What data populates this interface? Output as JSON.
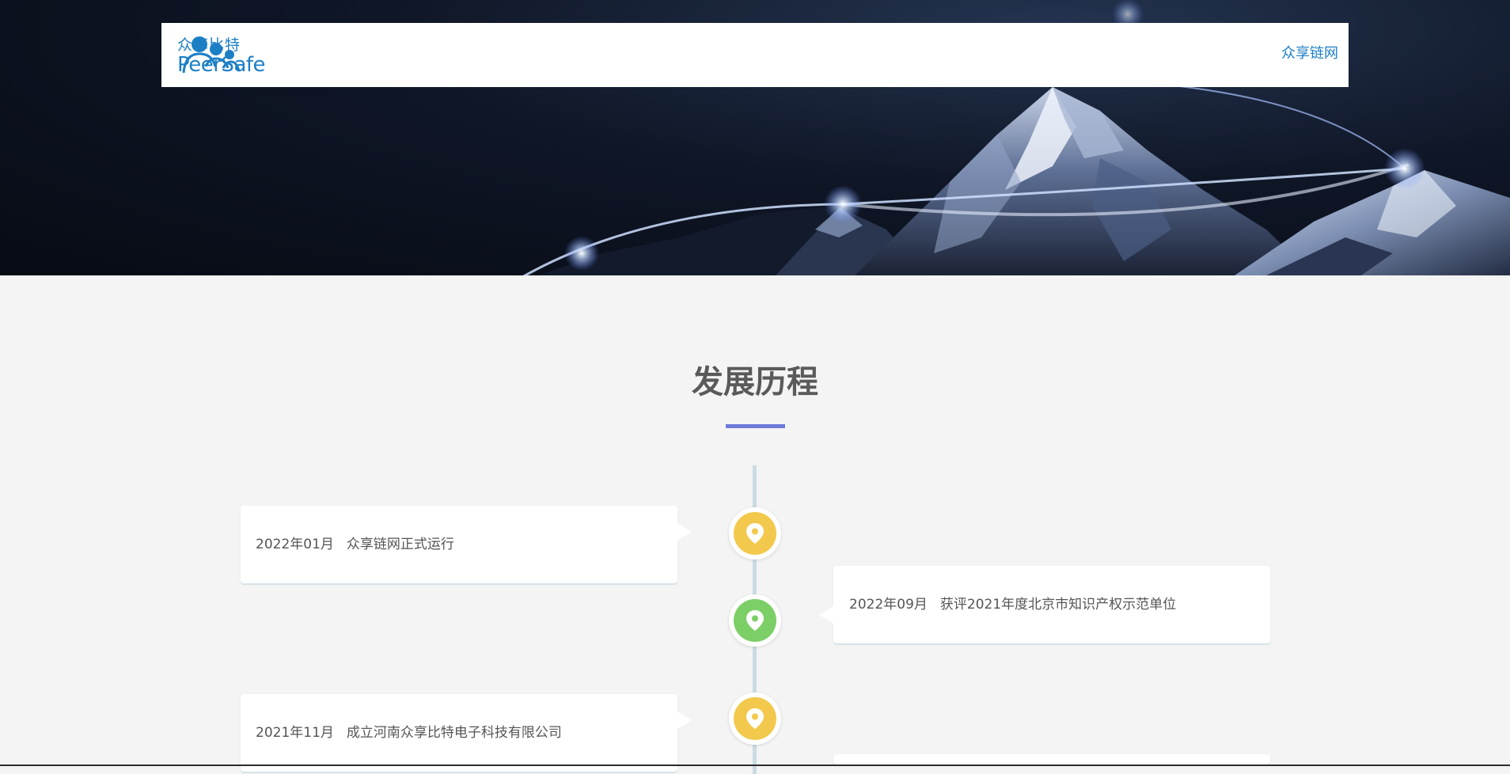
{
  "header": {
    "logo_cn": "众享比特",
    "logo_en": "PeerSafe",
    "nav_link": "众享链网"
  },
  "colors": {
    "brand_blue": "#1c7fc6",
    "underline": "#6b79d9",
    "marker_yellow": "#f2c94c",
    "marker_green": "#7ccf66",
    "timeline_line": "#c9dbe3"
  },
  "section": {
    "title": "发展历程"
  },
  "timeline": [
    {
      "date": "2022年01月",
      "event": "众享链网正式运行",
      "side": "left",
      "marker_color": "yellow",
      "icon": "map-pin-icon"
    },
    {
      "date": "2022年09月",
      "event": "获评2021年度北京市知识产权示范单位",
      "side": "right",
      "marker_color": "green",
      "icon": "map-pin-icon"
    },
    {
      "date": "2021年11月",
      "event": "成立河南众享比特电子科技有限公司",
      "side": "left",
      "marker_color": "yellow",
      "icon": "map-pin-icon"
    }
  ]
}
